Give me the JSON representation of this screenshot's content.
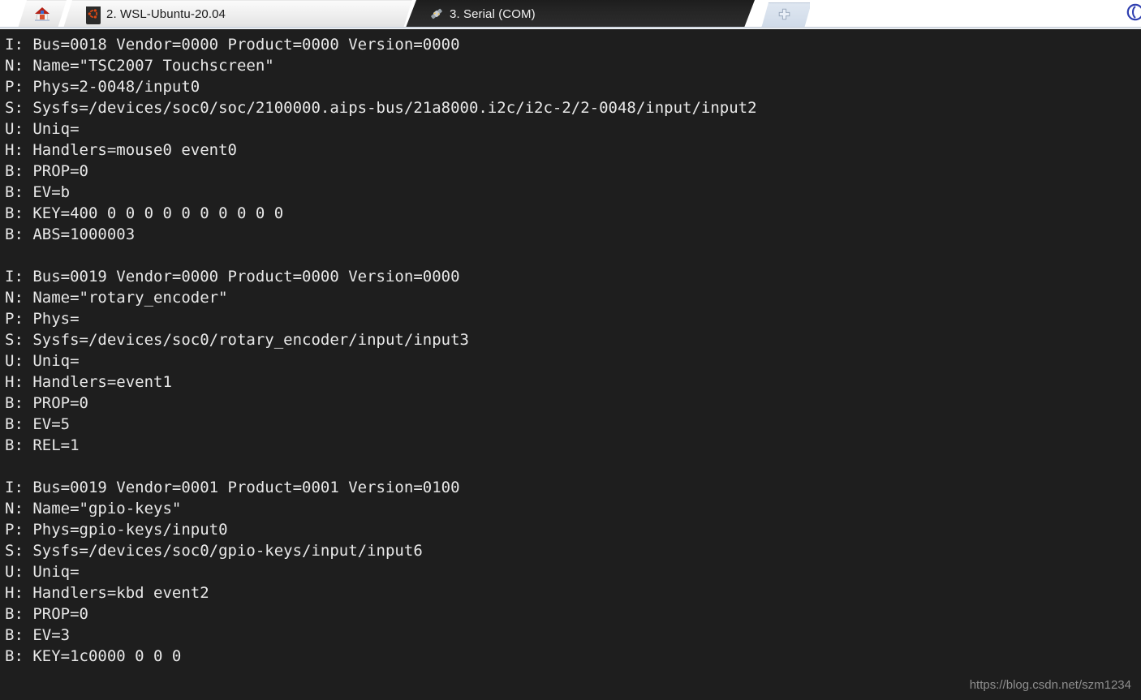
{
  "window": {
    "background_color": "#1e1e1e",
    "tabbar_background_color": "#ffffff",
    "terminal_text_color": "#e8e8e8"
  },
  "tabbar": {
    "tabs": [
      {
        "id": "home",
        "label": "",
        "icon": "home-icon",
        "active": false,
        "closable": false
      },
      {
        "id": "wsl",
        "label": "2. WSL-Ubuntu-20.04",
        "icon": "ubuntu-icon",
        "active": false,
        "closable": true,
        "close_label": "×"
      },
      {
        "id": "serial",
        "label": "3. Serial (COM)",
        "icon": "serial-plug-icon",
        "active": true,
        "closable": true,
        "close_label": "×"
      }
    ],
    "new_tab": {
      "label": "",
      "icon": "plus-icon",
      "tooltip": "New tab"
    },
    "corner_icon": "app-logo-icon"
  },
  "terminal": {
    "lines": [
      "I: Bus=0018 Vendor=0000 Product=0000 Version=0000",
      "N: Name=\"TSC2007 Touchscreen\"",
      "P: Phys=2-0048/input0",
      "S: Sysfs=/devices/soc0/soc/2100000.aips-bus/21a8000.i2c/i2c-2/2-0048/input/input2",
      "U: Uniq=",
      "H: Handlers=mouse0 event0",
      "B: PROP=0",
      "B: EV=b",
      "B: KEY=400 0 0 0 0 0 0 0 0 0 0",
      "B: ABS=1000003",
      "",
      "I: Bus=0019 Vendor=0000 Product=0000 Version=0000",
      "N: Name=\"rotary_encoder\"",
      "P: Phys=",
      "S: Sysfs=/devices/soc0/rotary_encoder/input/input3",
      "U: Uniq=",
      "H: Handlers=event1",
      "B: PROP=0",
      "B: EV=5",
      "B: REL=1",
      "",
      "I: Bus=0019 Vendor=0001 Product=0001 Version=0100",
      "N: Name=\"gpio-keys\"",
      "P: Phys=gpio-keys/input0",
      "S: Sysfs=/devices/soc0/gpio-keys/input/input6",
      "U: Uniq=",
      "H: Handlers=kbd event2",
      "B: PROP=0",
      "B: EV=3",
      "B: KEY=1c0000 0 0 0"
    ]
  },
  "watermark": {
    "text": "https://blog.csdn.net/szm1234"
  }
}
